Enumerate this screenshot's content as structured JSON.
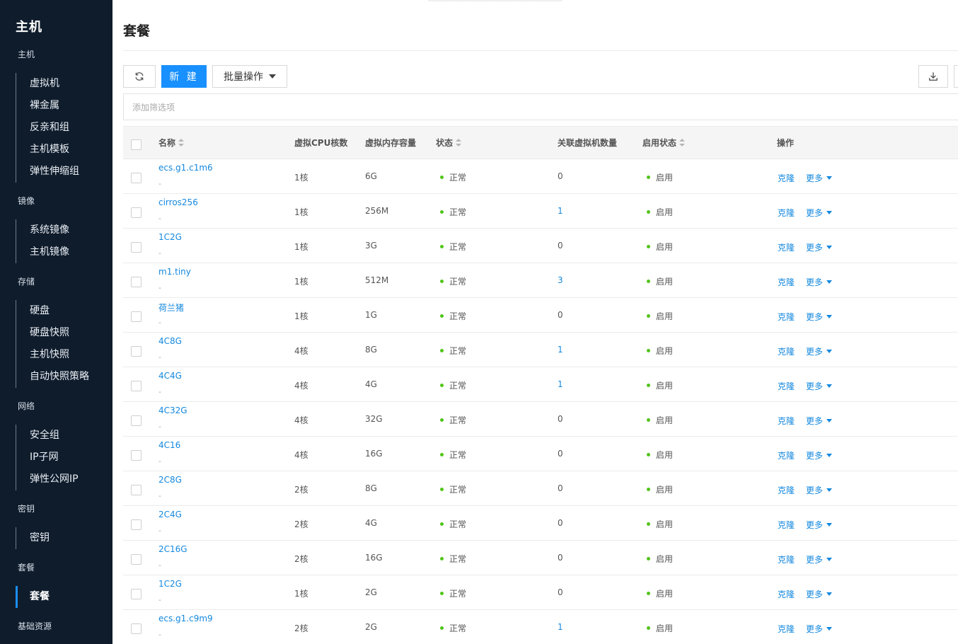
{
  "sidebar": {
    "title": "主机",
    "groups": [
      {
        "label": "主机",
        "items": [
          "虚拟机",
          "裸金属",
          "反亲和组",
          "主机模板",
          "弹性伸缩组"
        ]
      },
      {
        "label": "镜像",
        "items": [
          "系统镜像",
          "主机镜像"
        ]
      },
      {
        "label": "存储",
        "items": [
          "硬盘",
          "硬盘快照",
          "主机快照",
          "自动快照策略"
        ]
      },
      {
        "label": "网络",
        "items": [
          "安全组",
          "IP子网",
          "弹性公网IP"
        ]
      },
      {
        "label": "密钥",
        "items": [
          "密钥"
        ]
      },
      {
        "label": "套餐",
        "items": [
          "套餐"
        ]
      },
      {
        "label": "基础资源",
        "items": []
      }
    ],
    "active_item": "套餐"
  },
  "page": {
    "title": "套餐",
    "toolbar": {
      "new_label": "新 建",
      "batch_label": "批量操作"
    },
    "filter_placeholder": "添加筛选项"
  },
  "table": {
    "columns": [
      "名称",
      "虚拟CPU核数",
      "虚拟内存容量",
      "状态",
      "关联虚拟机数量",
      "启用状态",
      "操作"
    ],
    "rows": [
      {
        "name": "ecs.g1.c1m6",
        "desc": "-",
        "cpu": "1核",
        "mem": "6G",
        "status": "正常",
        "vms": "0",
        "enable": "启用"
      },
      {
        "name": "cirros256",
        "desc": "-",
        "cpu": "1核",
        "mem": "256M",
        "status": "正常",
        "vms": "1",
        "enable": "启用"
      },
      {
        "name": "1C2G",
        "desc": "-",
        "cpu": "1核",
        "mem": "3G",
        "status": "正常",
        "vms": "0",
        "enable": "启用"
      },
      {
        "name": "m1.tiny",
        "desc": "-",
        "cpu": "1核",
        "mem": "512M",
        "status": "正常",
        "vms": "3",
        "enable": "启用"
      },
      {
        "name": "荷兰猪",
        "desc": "-",
        "cpu": "1核",
        "mem": "1G",
        "status": "正常",
        "vms": "0",
        "enable": "启用"
      },
      {
        "name": "4C8G",
        "desc": "-",
        "cpu": "4核",
        "mem": "8G",
        "status": "正常",
        "vms": "1",
        "enable": "启用"
      },
      {
        "name": "4C4G",
        "desc": "-",
        "cpu": "4核",
        "mem": "4G",
        "status": "正常",
        "vms": "1",
        "enable": "启用"
      },
      {
        "name": "4C32G",
        "desc": "-",
        "cpu": "4核",
        "mem": "32G",
        "status": "正常",
        "vms": "0",
        "enable": "启用"
      },
      {
        "name": "4C16",
        "desc": "-",
        "cpu": "4核",
        "mem": "16G",
        "status": "正常",
        "vms": "0",
        "enable": "启用"
      },
      {
        "name": "2C8G",
        "desc": "-",
        "cpu": "2核",
        "mem": "8G",
        "status": "正常",
        "vms": "0",
        "enable": "启用"
      },
      {
        "name": "2C4G",
        "desc": "-",
        "cpu": "2核",
        "mem": "4G",
        "status": "正常",
        "vms": "0",
        "enable": "启用"
      },
      {
        "name": "2C16G",
        "desc": "-",
        "cpu": "2核",
        "mem": "16G",
        "status": "正常",
        "vms": "0",
        "enable": "启用"
      },
      {
        "name": "1C2G",
        "desc": "-",
        "cpu": "1核",
        "mem": "2G",
        "status": "正常",
        "vms": "0",
        "enable": "启用"
      },
      {
        "name": "ecs.g1.c9m9",
        "desc": "-",
        "cpu": "2核",
        "mem": "2G",
        "status": "正常",
        "vms": "1",
        "enable": "启用"
      }
    ],
    "actions": {
      "clone": "克隆",
      "more": "更多"
    }
  },
  "colors": {
    "sidebar_bg": "#0f1c2c",
    "primary": "#1890ff",
    "link": "#1488de",
    "status_ok": "#52c41a"
  },
  "icons": [
    "refresh-icon",
    "caret-down-icon",
    "download-icon",
    "sort-icon"
  ]
}
